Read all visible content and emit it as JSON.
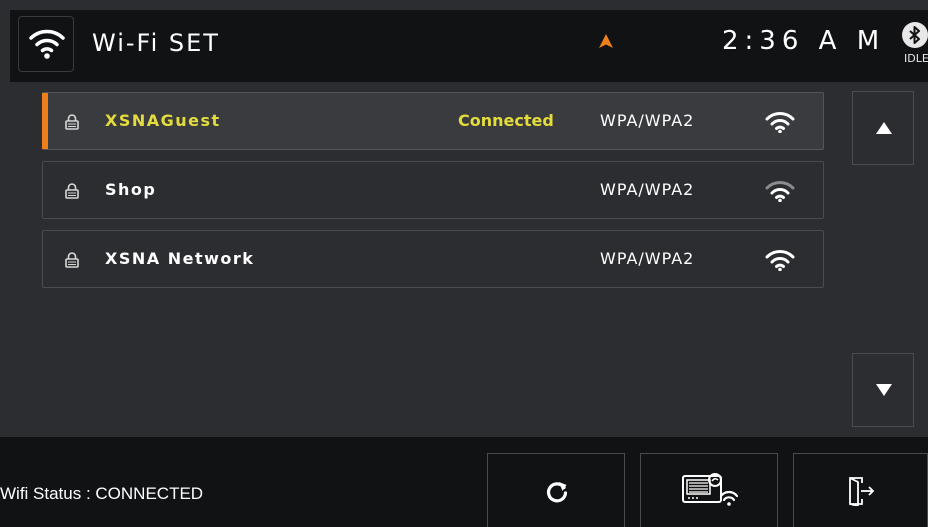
{
  "header": {
    "title": "Wi-Fi SET",
    "clock": "2:36 A M",
    "bluetooth_status": "IDLE",
    "icons": {
      "wifi": "wifi-icon",
      "navigation": "navigation-arrow-icon",
      "bluetooth": "bluetooth-icon"
    },
    "accent_color": "#ef7f1a"
  },
  "networks": [
    {
      "ssid": "XSNAGuest",
      "status": "Connected",
      "security": "WPA/WPA2",
      "selected": true,
      "signal_strength": 3
    },
    {
      "ssid": "Shop",
      "status": "",
      "security": "WPA/WPA2",
      "selected": false,
      "signal_strength": 2
    },
    {
      "ssid": "XSNA Network",
      "status": "",
      "security": "WPA/WPA2",
      "selected": false,
      "signal_strength": 3
    }
  ],
  "scroll": {
    "up_icon": "triangle-up-icon",
    "down_icon": "triangle-down-icon"
  },
  "footer": {
    "wifi_status": "Wifi Status : CONNECTED",
    "buttons": [
      {
        "name": "refresh",
        "icon": "refresh-icon"
      },
      {
        "name": "device-settings",
        "icon": "device-wifi-icon"
      },
      {
        "name": "exit",
        "icon": "exit-door-icon"
      }
    ]
  },
  "colors": {
    "connected_text": "#e4dc3c",
    "background": "#2c2d30",
    "bar": "#111214"
  }
}
